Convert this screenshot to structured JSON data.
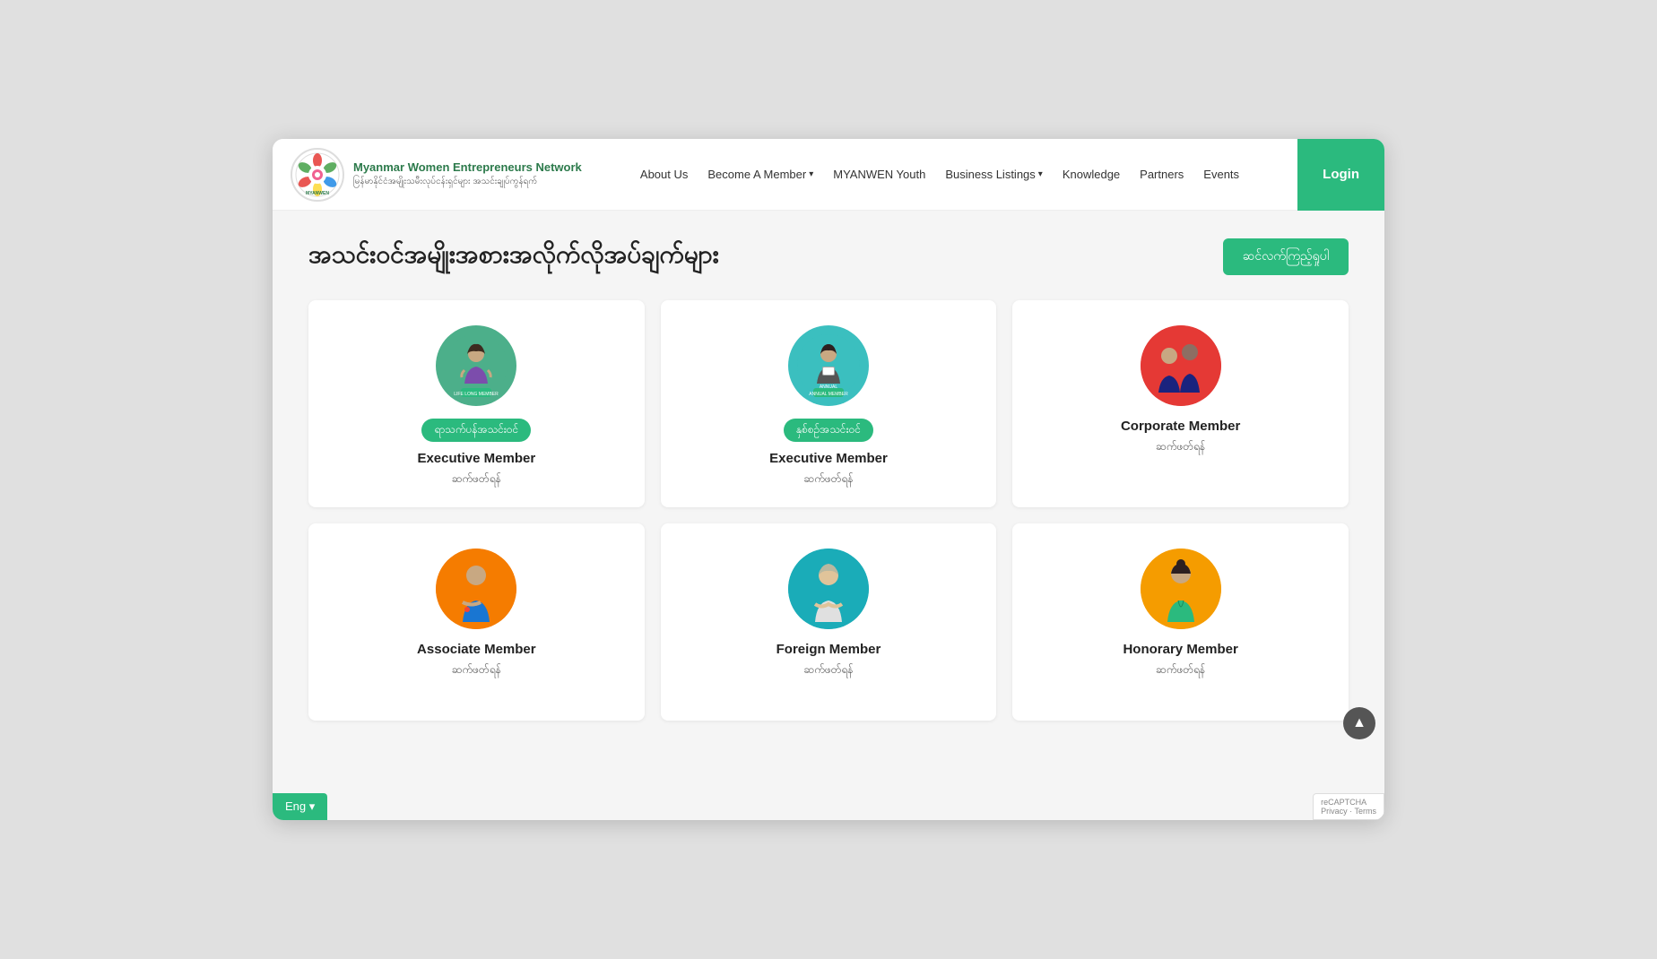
{
  "header": {
    "org_name_en": "Myanmar Women Entrepreneurs Network",
    "org_name_my": "မြန်မာနိုင်ငံအမျိုးသမီးလုပ်ငန်းရှင်များ အသင်းချုပ်ကွန်ရက်",
    "nav": [
      {
        "label": "About Us",
        "dropdown": false
      },
      {
        "label": "Become A Member",
        "dropdown": true
      },
      {
        "label": "MYANWEN Youth",
        "dropdown": false
      },
      {
        "label": "Business Listings",
        "dropdown": true
      },
      {
        "label": "Knowledge",
        "dropdown": false
      },
      {
        "label": "Partners",
        "dropdown": false
      },
      {
        "label": "Events",
        "dropdown": false
      }
    ],
    "login_label": "Login"
  },
  "page": {
    "title": "အသင်းဝင်အမျိုးအစားအလိုက်လိုအပ်ချက်များ",
    "filter_btn": "ဆင်လက်ကြည့်ရှုပါ"
  },
  "cards": [
    {
      "badge": "ရာသက်ပန်အသင်းဝင်",
      "title": "Executive Member",
      "subtitle": "ဆက်ဖတ်ရန်",
      "avatar_bg": "avatar-green",
      "type": "life_long"
    },
    {
      "badge": "နှစ်စဉ်အသင်းဝင်",
      "title": "Executive Member",
      "subtitle": "ဆက်ဖတ်ရန်",
      "avatar_bg": "avatar-teal",
      "type": "annual"
    },
    {
      "badge": null,
      "title": "Corporate Member",
      "subtitle": "ဆက်ဖတ်ရန်",
      "avatar_bg": "avatar-red",
      "type": "corporate"
    },
    {
      "badge": null,
      "title": "Associate Member",
      "subtitle": "ဆက်ဖတ်ရန်",
      "avatar_bg": "avatar-orange",
      "type": "associate"
    },
    {
      "badge": null,
      "title": "Foreign Member",
      "subtitle": "ဆက်ဖတ်ရန်",
      "avatar_bg": "avatar-cyan",
      "type": "foreign"
    },
    {
      "badge": null,
      "title": "Honorary Member",
      "subtitle": "ဆက်ဖတ်ရန်",
      "avatar_bg": "avatar-amber",
      "type": "honorary"
    }
  ],
  "lang_btn": "Eng",
  "scroll_top_icon": "▲",
  "recaptcha_text": "reCAPTCHA\nPrivacy - Terms"
}
